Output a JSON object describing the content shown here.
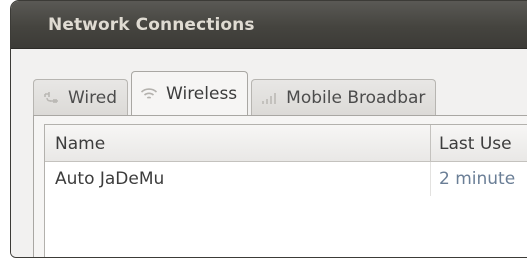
{
  "window": {
    "title": "Network Connections"
  },
  "tabs": [
    {
      "label": "Wired",
      "icon": "wired-icon",
      "active": false
    },
    {
      "label": "Wireless",
      "icon": "wireless-icon",
      "active": true
    },
    {
      "label": "Mobile Broadbar",
      "icon": "mobile-broadband-icon",
      "active": false
    }
  ],
  "table": {
    "columns": [
      "Name",
      "Last Use"
    ],
    "rows": [
      {
        "name": "Auto JaDeMu",
        "last_used": "2 minute"
      }
    ]
  },
  "colors": {
    "titlebar": "#3c3b37",
    "title_text": "#dfdbd2",
    "window_bg": "#f2f1f0",
    "last_used_text": "#6a7e96"
  }
}
